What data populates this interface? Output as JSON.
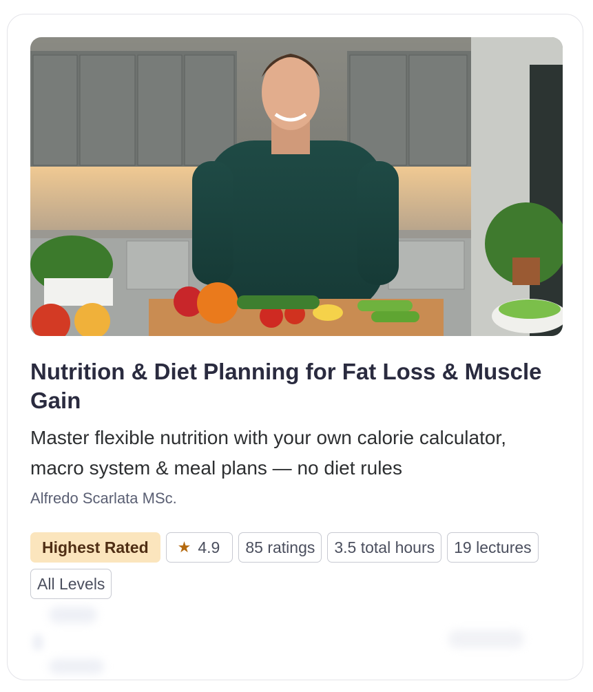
{
  "course": {
    "title": "Nutrition & Diet Planning for Fat Loss & Muscle Gain",
    "description": "Master flexible nutrition with your own calorie calculator, macro system & meal plans — no diet rules",
    "instructor": "Alfredo Scarlata MSc.",
    "thumbnail_alt": "Instructor in kitchen with vegetables",
    "badges": {
      "highlight": "Highest Rated",
      "rating": "4.9",
      "ratings_count": "85 ratings",
      "hours": "3.5 total hours",
      "lectures": "19 lectures",
      "level": "All Levels"
    },
    "icons": {
      "rating": "star-icon"
    },
    "colors": {
      "title": "#2a2b3f",
      "highlight_bg": "#fbe5bd",
      "highlight_text": "#4f2e14",
      "star": "#b4690e",
      "badge_border": "#c7c9d1"
    }
  }
}
